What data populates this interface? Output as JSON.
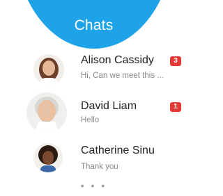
{
  "header": {
    "title": "Chats"
  },
  "chats": [
    {
      "name": "Alison Cassidy",
      "preview": "Hi, Can we meet this ...",
      "unread": "3",
      "avatar_icon": "woman-avatar-icon"
    },
    {
      "name": "David Liam",
      "preview": "Hello",
      "unread": "1",
      "avatar_icon": "man-avatar-icon"
    },
    {
      "name": "Catherine Sinu",
      "preview": "Thank you",
      "unread": "",
      "avatar_icon": "woman-avatar-icon"
    }
  ],
  "more": {
    "label": "• • •"
  },
  "colors": {
    "header": "#1ea3e8",
    "badge": "#e53935"
  }
}
